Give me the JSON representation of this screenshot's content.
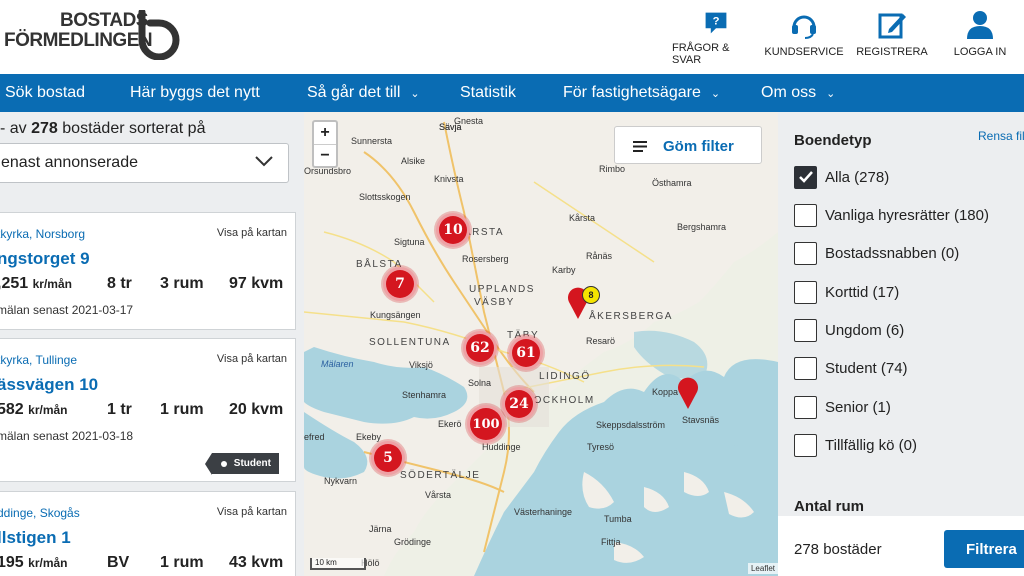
{
  "header": {
    "logo_line1": "BOSTADS",
    "logo_line2": "FÖRMEDLINGEN",
    "actions": [
      {
        "label": "FRÅGOR & SVAR",
        "icon": "question-bubble-icon"
      },
      {
        "label": "KUNDSERVICE",
        "icon": "headset-icon"
      },
      {
        "label": "REGISTRERA",
        "icon": "edit-icon"
      },
      {
        "label": "LOGGA IN",
        "icon": "user-icon"
      }
    ],
    "accent": "#0a6cb3"
  },
  "nav": [
    {
      "label": "Sök bostad"
    },
    {
      "label": "Här byggs det nytt"
    },
    {
      "label": "Så går det till",
      "chevron": "⌄"
    },
    {
      "label": "Statistik"
    },
    {
      "label": "För fastighetsägare",
      "chevron": "⌄"
    },
    {
      "label": "Om oss",
      "chevron": "⌄"
    }
  ],
  "results": {
    "prefix": "- av",
    "total": "278",
    "suffix": "bostäder sorterat på",
    "sort_value": "enast annonserade"
  },
  "listings": [
    {
      "location": "tkyrka, Norsborg",
      "map_link": "Visa på kartan",
      "address": "ngstorget 9",
      "rent": ",251",
      "rent_unit": "kr/mån",
      "floor": "8 tr",
      "rooms": "3 rum",
      "size": "97 kvm",
      "deadline": "mälan senast 2021-03-17"
    },
    {
      "location": "tkyrka, Tullinge",
      "map_link": "Visa på kartan",
      "address": "ässvägen 10",
      "rent": "582",
      "rent_unit": "kr/mån",
      "floor": "1 tr",
      "rooms": "1 rum",
      "size": "20 kvm",
      "deadline": "mälan senast 2021-03-18",
      "badge": "Student"
    },
    {
      "location": "ddinge, Skogås",
      "map_link": "Visa på kartan",
      "address": "llstigen 1",
      "rent": "195",
      "rent_unit": "kr/mån",
      "floor": "BV",
      "rooms": "1 rum",
      "size": "43 kvm"
    }
  ],
  "map": {
    "zoom_in": "+",
    "zoom_out": "−",
    "hide_filter": "Göm filter",
    "scale": "10 km",
    "attribution": "Leaflet",
    "clusters": [
      "10",
      "7",
      "62",
      "61",
      "24",
      "100",
      "5"
    ],
    "small_cluster": "8",
    "places": [
      "Sävja",
      "Gnesta",
      "Sunnersta",
      "Alsike",
      "Knivsta",
      "Rimbo",
      "Östhamra",
      "Orsundsbro",
      "Slottsskogen",
      "Kårsta",
      "Bergshamra",
      "Sigtuna",
      "ÄRSTA",
      "Rosersberg",
      "BÅLSTA",
      "UPPLANDS",
      "VÄSBY",
      "Karby",
      "Rånäs",
      "Kungsängen",
      "ÅKERSBERGA",
      "TÄBY",
      "SOLLENTUNA",
      "Resarö",
      "Mälaren",
      "Viksjö",
      "LIDINGÖ",
      "Solna",
      "Stenhamra",
      "STOCKHOLM",
      "Koppa",
      "Stavsnäs",
      "Ekerö",
      "Skeppsdalsström",
      "efred",
      "Ekeby",
      "Huddinge",
      "Tyresö",
      "Nykvarn",
      "SÖDERTÄLJE",
      "Vårsta",
      "Västerhaninge",
      "Järna",
      "Grödinge",
      "Hölö",
      "Tumba",
      "Fittja"
    ]
  },
  "filter": {
    "title": "Boendetyp",
    "reset": "Rensa fil",
    "options": [
      {
        "label": "Alla (278)",
        "checked": true
      },
      {
        "label": "Vanliga hyresrätter (180)",
        "checked": false
      },
      {
        "label": "Bostadssnabben (0)",
        "checked": false
      },
      {
        "label": "Korttid (17)",
        "checked": false
      },
      {
        "label": "Ungdom (6)",
        "checked": false
      },
      {
        "label": "Student (74)",
        "checked": false
      },
      {
        "label": "Senior (1)",
        "checked": false
      },
      {
        "label": "Tillfällig kö (0)",
        "checked": false
      }
    ],
    "next_section": "Antal rum",
    "footer_count": "278 bostäder",
    "footer_button": "Filtrera"
  }
}
